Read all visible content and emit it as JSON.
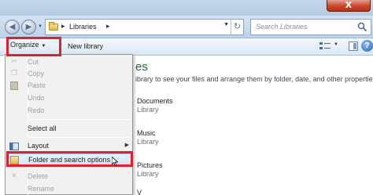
{
  "window": {
    "close_glyph": "X"
  },
  "navigation": {
    "back_glyph": "◀",
    "forward_glyph": "▶",
    "history_glyph": "▼"
  },
  "address_bar": {
    "separator": "▸",
    "path": "Libraries",
    "trailing_separator": "▸",
    "dropdown_glyph": "▼",
    "refresh_glyph": "↻"
  },
  "search": {
    "placeholder": "Search Libraries"
  },
  "commandbar": {
    "organize_label": "Organize",
    "organize_arrow": "▼",
    "new_library_label": "New library",
    "view_arrow": "▼",
    "help_glyph": "?"
  },
  "content": {
    "heading_fragment": "es",
    "description_fragment": "ibrary to see your files and arrange them by folder, date, and other properties.",
    "libraries": [
      {
        "name": "Documents",
        "type": "Library"
      },
      {
        "name": "Music",
        "type": "Library"
      },
      {
        "name": "Pictures",
        "type": "Library"
      }
    ],
    "partial_fragment": "V"
  },
  "menu": {
    "items": [
      {
        "label": "Cut",
        "icon": "scissors-icon",
        "glyph": "✂",
        "enabled": false
      },
      {
        "label": "Copy",
        "icon": "copy-icon",
        "glyph": "❐",
        "enabled": false
      },
      {
        "label": "Paste",
        "icon": "paste-icon",
        "glyph": "📋",
        "enabled": false
      },
      {
        "label": "Undo",
        "enabled": false
      },
      {
        "label": "Redo",
        "enabled": false
      },
      {
        "label": "Select all",
        "enabled": true
      },
      {
        "label": "Layout",
        "icon": "layout-icon",
        "enabled": true,
        "submenu_glyph": "▶"
      },
      {
        "label": "Folder and search options",
        "icon": "folder-options-icon",
        "enabled": true,
        "highlighted": true
      },
      {
        "label": "Delete",
        "icon": "delete-icon",
        "glyph": "✕",
        "enabled": false
      },
      {
        "label": "Rename",
        "enabled": false
      }
    ]
  },
  "colors": {
    "annotation_red": "#e0202e",
    "heading_green": "#1c6b2a",
    "menu_background": "#f1f1f1"
  }
}
